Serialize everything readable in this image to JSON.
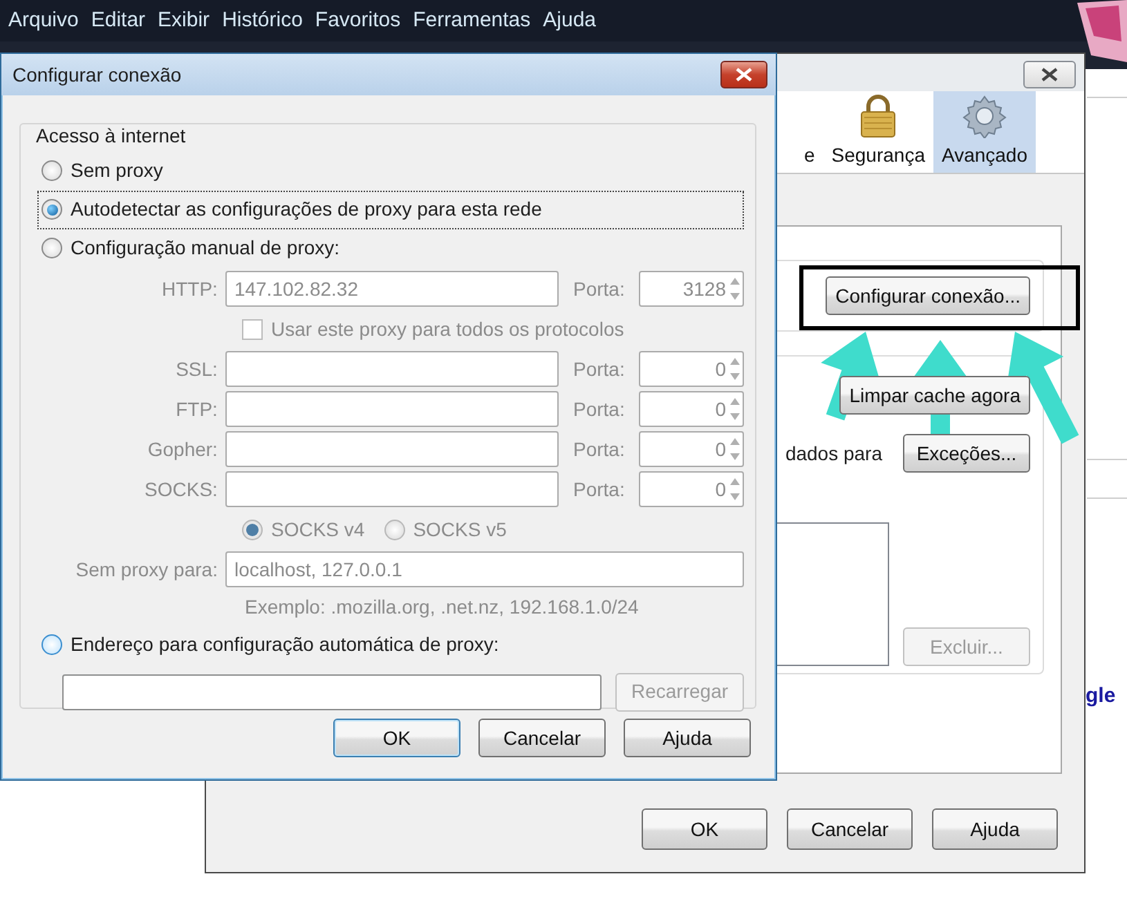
{
  "menu_bar": [
    {
      "label": "Arquivo"
    },
    {
      "label": "Editar"
    },
    {
      "label": "Exibir"
    },
    {
      "label": "Histórico"
    },
    {
      "label": "Favoritos"
    },
    {
      "label": "Ferramentas"
    },
    {
      "label": "Ajuda"
    }
  ],
  "options_window": {
    "tabs": [
      {
        "label": "e",
        "kind": "plain",
        "selected": false
      },
      {
        "label": "Segurança",
        "kind": "lock",
        "selected": false
      },
      {
        "label": "Avançado",
        "kind": "gear",
        "selected": true
      }
    ],
    "connection_button": "Configurar conexão...",
    "cache_button": "Limpar cache agora",
    "offline_text": "dados para",
    "exceptions_button": "Exceções...",
    "delete_button": {
      "label": "Excluir...",
      "disabled": true
    },
    "buttons": [
      "OK",
      "Cancelar",
      "Ajuda"
    ]
  },
  "page_text": "gle",
  "connection_dialog": {
    "title": "Configurar conexão",
    "group_title": "Acesso à internet",
    "no_proxy": {
      "label": "Sem proxy",
      "selected": false,
      "focused": false
    },
    "auto_detect": {
      "label": "Autodetectar as configurações de proxy para esta rede",
      "selected": true,
      "focused": true
    },
    "manual": {
      "radio": {
        "label": "Configuração manual de proxy:",
        "selected": false,
        "focused": false
      },
      "disabled": true,
      "proxies": [
        {
          "label": "HTTP:",
          "value": "147.102.82.32",
          "port_label": "Porta:",
          "port": "3128"
        },
        {
          "label": "SSL:",
          "port_label": "Porta:",
          "port": "0"
        },
        {
          "label": "FTP:",
          "port_label": "Porta:",
          "port": "0"
        },
        {
          "label": "Gopher:",
          "port_label": "Porta:",
          "port": "0"
        },
        {
          "label": "SOCKS:",
          "port_label": "Porta:",
          "port": "0"
        }
      ],
      "share_all": {
        "label": "Usar este proxy para todos os protocolos",
        "checked": false
      },
      "socks_versions": [
        {
          "label": "SOCKS v4",
          "selected": true
        },
        {
          "label": "SOCKS v5",
          "selected": false
        }
      ],
      "no_proxy_for": {
        "label": "Sem proxy para:",
        "value": "localhost, 127.0.0.1"
      },
      "example": "Exemplo: .mozilla.org, .net.nz, 192.168.1.0/24"
    },
    "auto_config": {
      "radio": {
        "label": "Endereço para configuração automática de proxy:",
        "selected": false,
        "focused": false
      },
      "button": {
        "label": "Recarregar",
        "disabled": true
      }
    },
    "buttons": [
      {
        "label": "OK",
        "default": true
      },
      {
        "label": "Cancelar",
        "default": false
      },
      {
        "label": "Ajuda",
        "default": false
      }
    ]
  }
}
